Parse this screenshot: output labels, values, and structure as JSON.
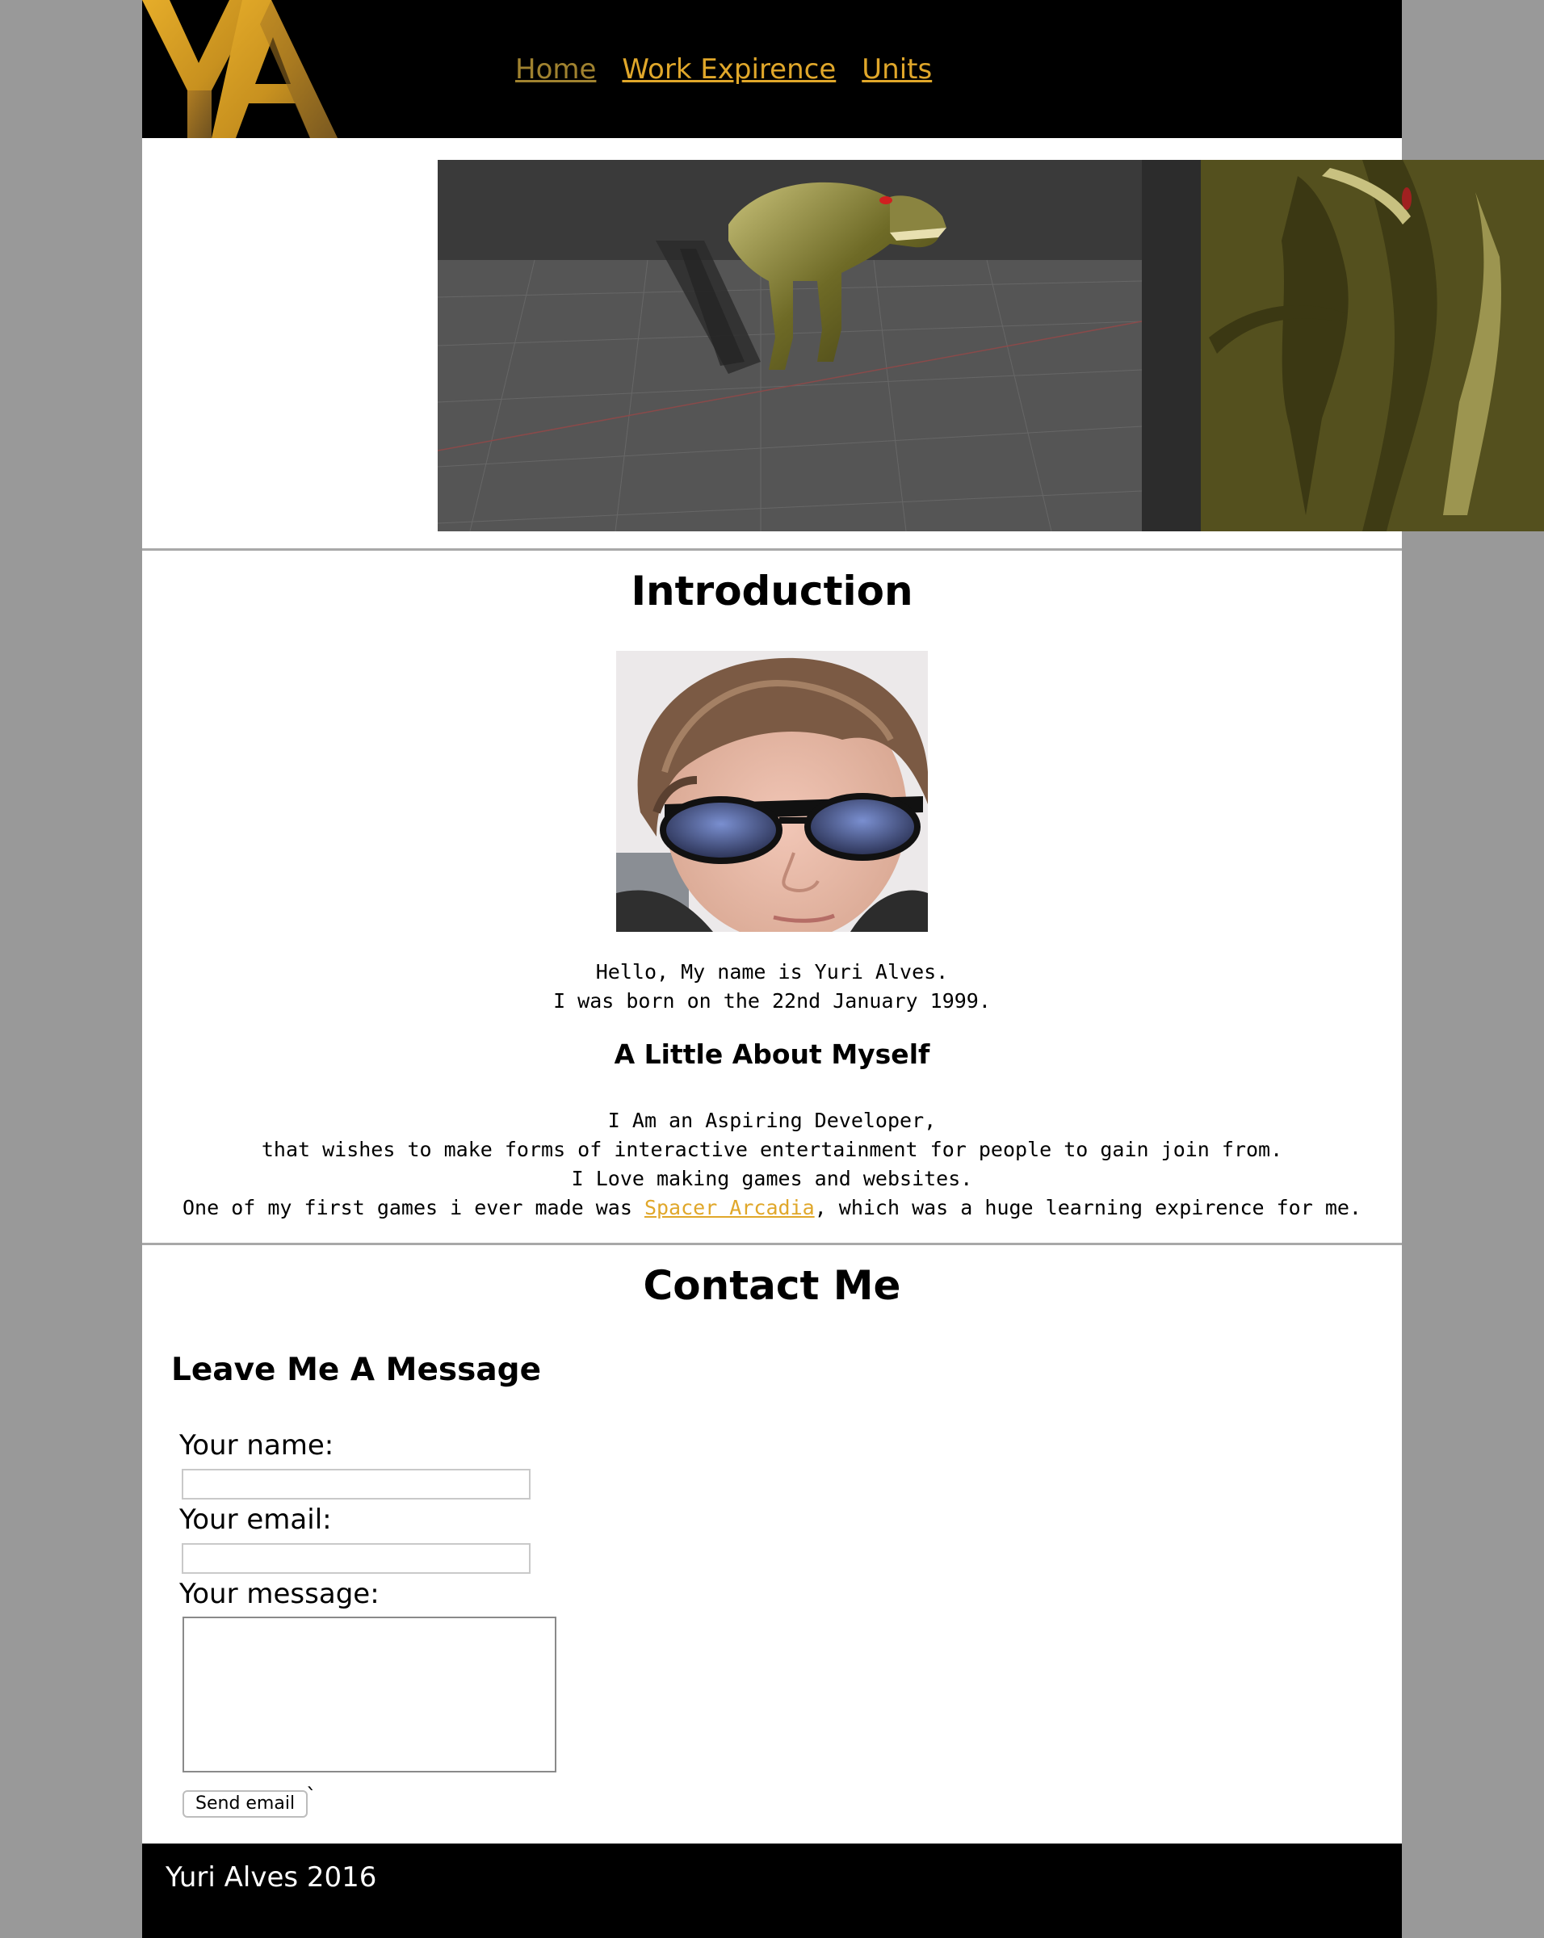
{
  "header": {
    "logo_text": "YA",
    "nav": [
      {
        "label": "Home"
      },
      {
        "label": "Work Expirence"
      },
      {
        "label": "Units"
      }
    ]
  },
  "intro": {
    "heading": "Introduction",
    "lines": [
      "Hello, My name is Yuri Alves.",
      "I was born on the 22nd January 1999."
    ]
  },
  "about": {
    "heading": "A Little About Myself",
    "lines": [
      "I Am an Aspiring Developer,",
      "that wishes to make forms of interactive entertainment for people to gain join from.",
      "I Love making games and websites."
    ],
    "last_line_prefix": "One of my first games i ever made was ",
    "game_link": "Spacer Arcadia",
    "last_line_suffix": ", which was a huge learning expirence for me."
  },
  "contact": {
    "heading": "Contact Me",
    "subheading": "Leave Me A Message",
    "name_label": "Your name:",
    "name_value": "",
    "email_label": "Your email:",
    "email_value": "",
    "message_label": "Your message:",
    "message_value": "",
    "send_label": "Send email",
    "stray_mark": "`"
  },
  "footer": {
    "text": "Yuri Alves 2016"
  },
  "colors": {
    "link": "#e0a72a",
    "visited_link": "#a0822f",
    "header_bg": "#000000",
    "page_bg": "#999999"
  }
}
